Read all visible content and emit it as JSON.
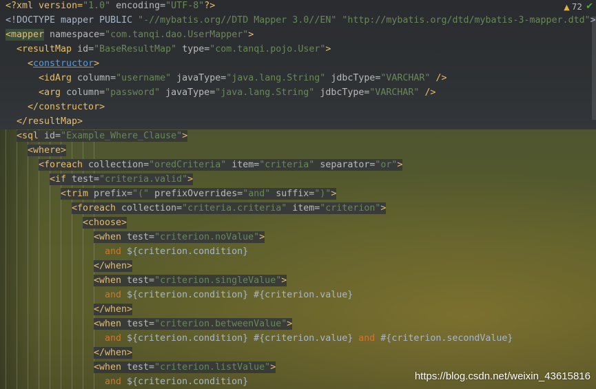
{
  "status": {
    "warning_count": "72"
  },
  "watermark": "https://blog.csdn.net/weixin_43615816",
  "code": {
    "l1_a": "<?xml version=",
    "l1_b": "\"1.0\"",
    "l1_c": " encoding=",
    "l1_d": "\"UTF-8\"",
    "l1_e": "?>",
    "l2_a": "<!DOCTYPE mapper PUBLIC ",
    "l2_b": "\"-//mybatis.org//DTD Mapper 3.0//EN\"",
    "l2_c": " ",
    "l2_d": "\"http://mybatis.org/dtd/mybatis-3-mapper.dtd\"",
    "l2_e": ">",
    "l3_a": "<mapper",
    "l3_b": " namespace=",
    "l3_c": "\"com.tanqi.dao.UserMapper\"",
    "l3_d": ">",
    "l4_a": "<resultMap",
    "l4_b": " id=",
    "l4_c": "\"BaseResultMap\"",
    "l4_d": " type=",
    "l4_e": "\"com.tanqi.pojo.User\"",
    "l4_f": ">",
    "l5_a": "<",
    "l5_b": "constructor",
    "l5_c": ">",
    "l6_a": "<idArg",
    "l6_b": " column=",
    "l6_c": "\"username\"",
    "l6_d": " javaType=",
    "l6_e": "\"java.lang.String\"",
    "l6_f": " jdbcType=",
    "l6_g": "\"VARCHAR\"",
    "l6_h": " />",
    "l7_a": "<arg",
    "l7_b": " column=",
    "l7_c": "\"password\"",
    "l7_d": " javaType=",
    "l7_e": "\"java.lang.String\"",
    "l7_f": " jdbcType=",
    "l7_g": "\"VARCHAR\"",
    "l7_h": " />",
    "l8": "</constructor>",
    "l9": "</resultMap>",
    "l10_a": "<sql",
    "l10_b": " id=",
    "l10_c": "\"Example_Where_Clause\"",
    "l10_d": ">",
    "l11": "<where>",
    "l12_a": "<foreach",
    "l12_b": " collection=",
    "l12_c": "\"oredCriteria\"",
    "l12_d": " item=",
    "l12_e": "\"criteria\"",
    "l12_f": " separator=",
    "l12_g": "\"or\"",
    "l12_h": ">",
    "l13_a": "<if",
    "l13_b": " test=",
    "l13_c": "\"criteria.valid\"",
    "l13_d": ">",
    "l14_a": "<trim",
    "l14_b": " prefix=",
    "l14_c": "\"(\"",
    "l14_d": " prefixOverrides=",
    "l14_e": "\"and\"",
    "l14_f": " suffix=",
    "l14_g": "\")\"",
    "l14_h": ">",
    "l15_a": "<foreach",
    "l15_b": " collection=",
    "l15_c": "\"criteria.criteria\"",
    "l15_d": " item=",
    "l15_e": "\"criterion\"",
    "l15_f": ">",
    "l16": "<choose>",
    "l17_a": "<when",
    "l17_b": " test=",
    "l17_c": "\"criterion.noValue\"",
    "l17_d": ">",
    "l18_a": "and",
    "l18_b": " ${criterion.condition}",
    "l19": "</when>",
    "l20_a": "<when",
    "l20_b": " test=",
    "l20_c": "\"criterion.singleValue\"",
    "l20_d": ">",
    "l21_a": "and",
    "l21_b": " ${criterion.condition} #{criterion.value}",
    "l22": "</when>",
    "l23_a": "<when",
    "l23_b": " test=",
    "l23_c": "\"criterion.betweenValue\"",
    "l23_d": ">",
    "l24_a": "and",
    "l24_b": " ${criterion.condition} #{criterion.value} ",
    "l24_c": "and",
    "l24_d": " #{criterion.secondValue}",
    "l25": "</when>",
    "l26_a": "<when",
    "l26_b": " test=",
    "l26_c": "\"criterion.listValue\"",
    "l26_d": ">",
    "l27_a": "and",
    "l27_b": " ${criterion.condition}"
  }
}
